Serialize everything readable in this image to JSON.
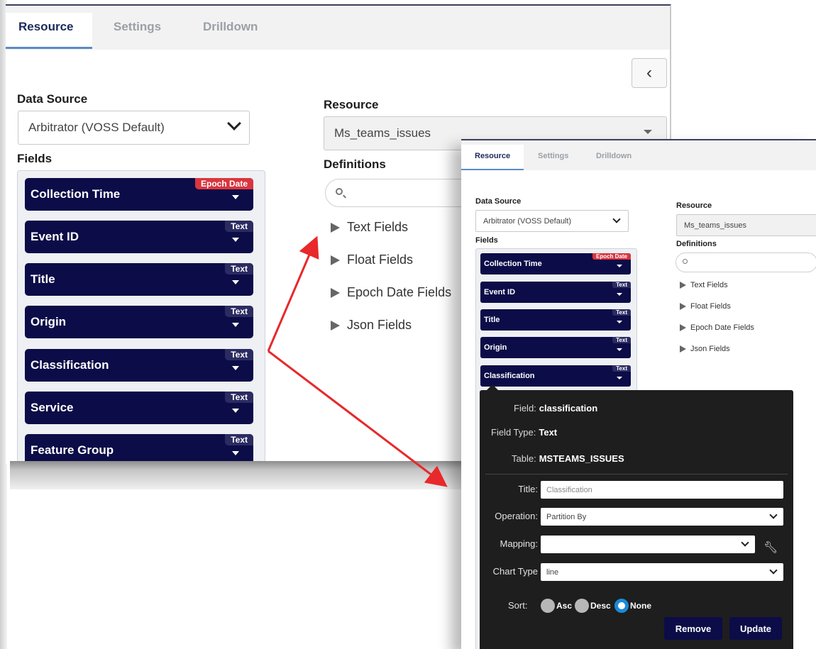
{
  "tabs": [
    "Resource",
    "Settings",
    "Drilldown"
  ],
  "labels": {
    "data_source": "Data Source",
    "fields": "Fields",
    "resource": "Resource",
    "definitions": "Definitions"
  },
  "data_source_value": "Arbitrator (VOSS Default)",
  "resource_value": "Ms_teams_issues",
  "fields": [
    {
      "name": "Collection Time",
      "type": "Epoch Date"
    },
    {
      "name": "Event ID",
      "type": "Text"
    },
    {
      "name": "Title",
      "type": "Text"
    },
    {
      "name": "Origin",
      "type": "Text"
    },
    {
      "name": "Classification",
      "type": "Text"
    },
    {
      "name": "Service",
      "type": "Text"
    },
    {
      "name": "Feature Group",
      "type": "Text"
    }
  ],
  "definitions": [
    "Text Fields",
    "Float Fields",
    "Epoch Date Fields",
    "Json Fields"
  ],
  "popup": {
    "field_label": "Field:",
    "field_value": "classification",
    "field_type_label": "Field Type:",
    "field_type_value": "Text",
    "table_label": "Table:",
    "table_value": "MSTEAMS_ISSUES",
    "title_label": "Title:",
    "title_placeholder": "Classification",
    "operation_label": "Operation:",
    "operation_value": "Partition By",
    "mapping_label": "Mapping:",
    "mapping_value": "",
    "chart_type_label": "Chart Type",
    "chart_type_value": "line",
    "sort_label": "Sort:",
    "sort_options": [
      "Asc",
      "Desc",
      "None"
    ],
    "sort_selected": "None",
    "remove_label": "Remove",
    "update_label": "Update"
  },
  "colors": {
    "field_bg": "#0c0c48",
    "epoch_tag": "#d9363e",
    "arrow": "#e8282b",
    "radio_on": "#1a8ad8"
  }
}
